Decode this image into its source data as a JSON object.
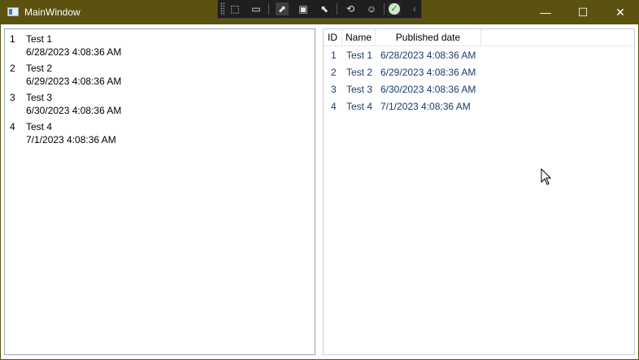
{
  "window": {
    "title": "MainWindow",
    "minimize_glyph": "—",
    "maximize_glyph": "☐",
    "close_glyph": "✕"
  },
  "devtools": {
    "tools": [
      {
        "name": "select-element-icon",
        "glyph": "⬚"
      },
      {
        "name": "record-icon",
        "glyph": "▭"
      },
      {
        "name": "display-adorners-icon",
        "glyph": "⬈"
      },
      {
        "name": "track-focus-icon",
        "glyph": "▣"
      },
      {
        "name": "binding-failures-icon",
        "glyph": "⬉"
      },
      {
        "name": "hot-reload-icon",
        "glyph": "⟲"
      },
      {
        "name": "accessibility-icon",
        "glyph": "☺"
      },
      {
        "name": "status-check-icon",
        "glyph": "✓"
      },
      {
        "name": "collapse-icon",
        "glyph": "‹"
      }
    ]
  },
  "list_box": {
    "items": [
      {
        "id": "1",
        "name": "Test 1",
        "date": "6/28/2023 4:08:36 AM"
      },
      {
        "id": "2",
        "name": "Test 2",
        "date": "6/29/2023 4:08:36 AM"
      },
      {
        "id": "3",
        "name": "Test 3",
        "date": "6/30/2023 4:08:36 AM"
      },
      {
        "id": "4",
        "name": "Test 4",
        "date": "7/1/2023 4:08:36 AM"
      }
    ]
  },
  "list_view": {
    "columns": [
      "ID",
      "Name",
      "Published date"
    ],
    "rows": [
      {
        "id": "1",
        "name": "Test 1",
        "date": "6/28/2023 4:08:36 AM"
      },
      {
        "id": "2",
        "name": "Test 2",
        "date": "6/29/2023 4:08:36 AM"
      },
      {
        "id": "3",
        "name": "Test 3",
        "date": "6/30/2023 4:08:36 AM"
      },
      {
        "id": "4",
        "name": "Test 4",
        "date": "7/1/2023 4:08:36 AM"
      }
    ]
  },
  "colors": {
    "title_bar": "#5b5210",
    "row_text": "#1a3a6e"
  }
}
